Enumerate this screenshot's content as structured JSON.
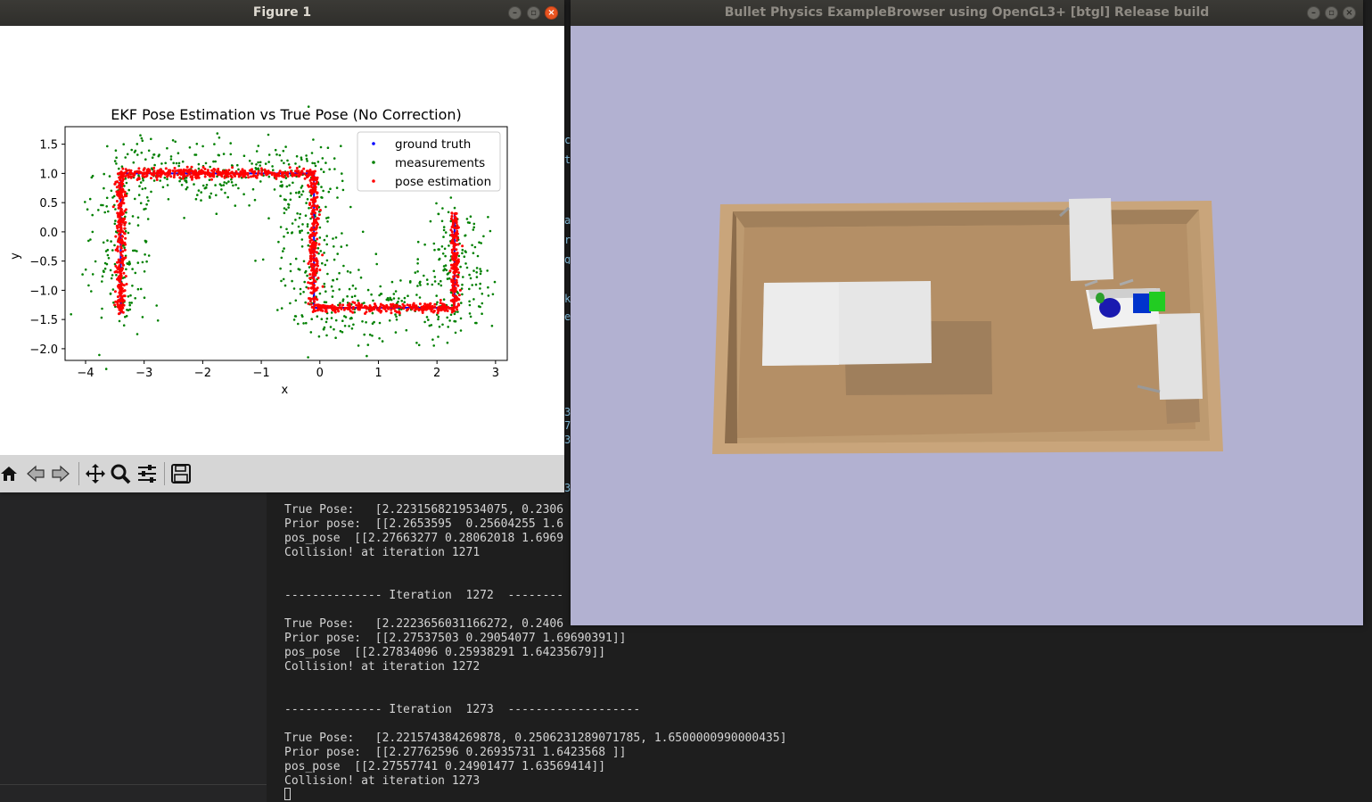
{
  "figure_window": {
    "title": "Figure 1",
    "toolbar": {
      "home": "home-icon",
      "back": "back-arrow-icon",
      "forward": "forward-arrow-icon",
      "pan": "pan-move-icon",
      "zoom": "zoom-magnifier-icon",
      "configure": "configure-subplots-icon",
      "save": "save-disk-icon"
    }
  },
  "bullet_window": {
    "title": "Bullet Physics ExampleBrowser using OpenGL3+ [btgl] Release build"
  },
  "terminal": {
    "lines": [
      "True Pose:   [2.2231568219534075, 0.2306",
      "Prior pose:  [[2.2653595  0.25604255 1.6",
      "pos_pose  [[2.27663277 0.28062018 1.6969",
      "Collision! at iteration 1271",
      "",
      "",
      "-------------- Iteration  1272  --------",
      "",
      "True Pose:   [2.2223656031166272, 0.2406",
      "Prior pose:  [[2.27537503 0.29054077 1.69690391]]",
      "pos_pose  [[2.27834096 0.25938291 1.64235679]]",
      "Collision! at iteration 1272",
      "",
      "",
      "-------------- Iteration  1273  -------------------",
      "",
      "True Pose:   [2.221574384269878, 0.2506231289071785, 1.6500000990000435]",
      "Prior pose:  [[2.27762596 0.26935731 1.6423568 ]]",
      "pos_pose  [[2.27557741 0.24901477 1.63569414]]",
      "Collision! at iteration 1273"
    ],
    "peek_chars": [
      "c",
      "t",
      "a",
      "r",
      "g",
      "k",
      "e",
      "3",
      "7",
      "3",
      "3"
    ]
  },
  "colors": {
    "ground_truth": "#0000ff",
    "measurements": "#008000",
    "pose_estimation": "#ff0000",
    "bullet_bg": "#b2b1d1",
    "table_wood": "#c8a47a"
  },
  "chart_data": {
    "type": "scatter",
    "title": "EKF Pose Estimation vs True Pose (No Correction)",
    "xlabel": "x",
    "ylabel": "y",
    "xlim": [
      -4.35,
      3.2
    ],
    "ylim": [
      -2.2,
      1.8
    ],
    "xticks": [
      "−4",
      "−3",
      "−2",
      "−1",
      "0",
      "1",
      "2",
      "3"
    ],
    "xtick_values": [
      -4,
      -3,
      -2,
      -1,
      0,
      1,
      2,
      3
    ],
    "yticks": [
      "1.5",
      "1.0",
      "0.5",
      "0.0",
      "−0.5",
      "−1.0",
      "−1.5",
      "−2.0"
    ],
    "ytick_values": [
      1.5,
      1.0,
      0.5,
      0.0,
      -0.5,
      -1.0,
      -1.5,
      -2.0
    ],
    "legend_position": "top-right",
    "grid": false,
    "path_waypoints": [
      [
        -3.4,
        -1.4
      ],
      [
        -3.4,
        1.0
      ],
      [
        -0.1,
        1.0
      ],
      [
        -0.1,
        -1.3
      ],
      [
        2.3,
        -1.3
      ],
      [
        2.3,
        0.3
      ]
    ],
    "noise": {
      "measurements_sigma": 0.3,
      "estimate_sigma": 0.04
    },
    "series": [
      {
        "name": "ground truth",
        "color": "#0000ff",
        "kind": "path"
      },
      {
        "name": "measurements",
        "color": "#008000",
        "kind": "noisy-points",
        "count": 900
      },
      {
        "name": "pose estimation",
        "color": "#ff0000",
        "kind": "near-path-points",
        "count": 1400
      }
    ]
  }
}
